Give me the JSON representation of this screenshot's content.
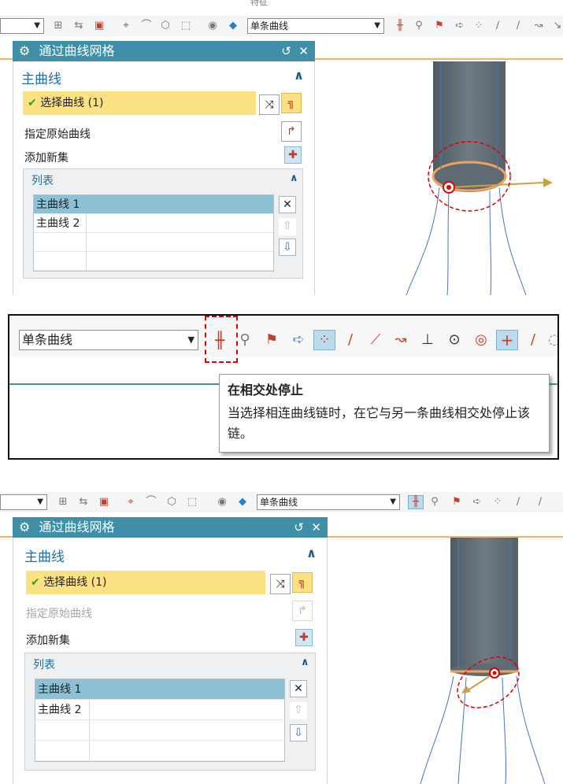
{
  "top_label": "特征",
  "toolbar_icons": [
    "curve-rule-icon",
    "section-icon",
    "feature-box-icon",
    "snap-icon",
    "fillet-icon",
    "edge-blend-icon",
    "select-rect-icon",
    "shade-icon",
    "cube-view-icon"
  ],
  "selection_filter": {
    "value": "单条曲线"
  },
  "tool_icons": [
    "stop-at-intersection-icon",
    "follow-fillet-icon",
    "chain-within-feature-icon",
    "path-arrow-icon",
    "snap-point-icon",
    "end-point-icon",
    "mid-point-icon",
    "control-point-icon",
    "intersection-point-icon",
    "arc-center-icon",
    "quadrant-point-icon",
    "existing-point-icon",
    "point-on-curve-icon"
  ],
  "dialog": {
    "title": "通过曲线网格",
    "header_icons": [
      "reset-icon",
      "close-icon"
    ],
    "section_title": "主曲线",
    "select_curve_label": "选择曲线 (1)",
    "specify_origin_label": "指定原始曲线",
    "add_set_label": "添加新集",
    "list_title": "列表",
    "list_items": [
      "主曲线 1",
      "主曲线 2"
    ]
  },
  "tooltip": {
    "title": "在相交处停止",
    "text": "当选择相连曲线链时，在它与另一条曲线相交处停止该链。"
  },
  "colors": {
    "accent": "#3f8fa8",
    "selection_yellow": "#fce183",
    "list_selected": "#8dc2d6",
    "highlight_red": "#e00000"
  }
}
